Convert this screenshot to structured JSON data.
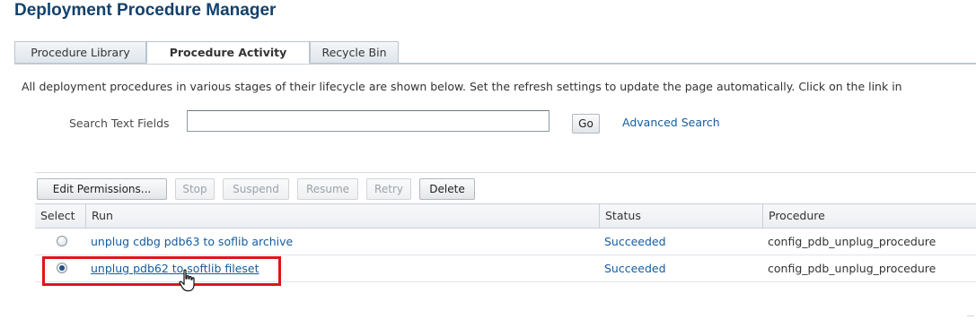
{
  "page": {
    "title": "Deployment Procedure Manager"
  },
  "tabs": [
    {
      "label": "Procedure Library",
      "active": false
    },
    {
      "label": "Procedure Activity",
      "active": true
    },
    {
      "label": "Recycle Bin",
      "active": false
    }
  ],
  "description": "All deployment procedures in various stages of their lifecycle are shown below. Set the refresh settings to update the page automatically. Click on the link in",
  "search": {
    "label": "Search Text Fields",
    "value": "",
    "go_label": "Go",
    "advanced_label": "Advanced Search"
  },
  "toolbar": {
    "edit_permissions": "Edit Permissions...",
    "stop": "Stop",
    "suspend": "Suspend",
    "resume": "Resume",
    "retry": "Retry",
    "delete": "Delete"
  },
  "table": {
    "columns": [
      "Select",
      "Run",
      "Status",
      "Procedure"
    ],
    "rows": [
      {
        "run": "unplug cdbg pdb63 to soflib archive",
        "status": "Succeeded",
        "procedure": "config_pdb_unplug_procedure",
        "selected": false
      },
      {
        "run": "unplug pdb62 to softlib fileset",
        "status": "Succeeded",
        "procedure": "config_pdb_unplug_procedure",
        "selected": true
      }
    ]
  },
  "colors": {
    "title": "#13416b",
    "link": "#145c9e",
    "highlight": "#e0141b"
  },
  "icons": {
    "cursor": "hand-pointer-icon"
  }
}
